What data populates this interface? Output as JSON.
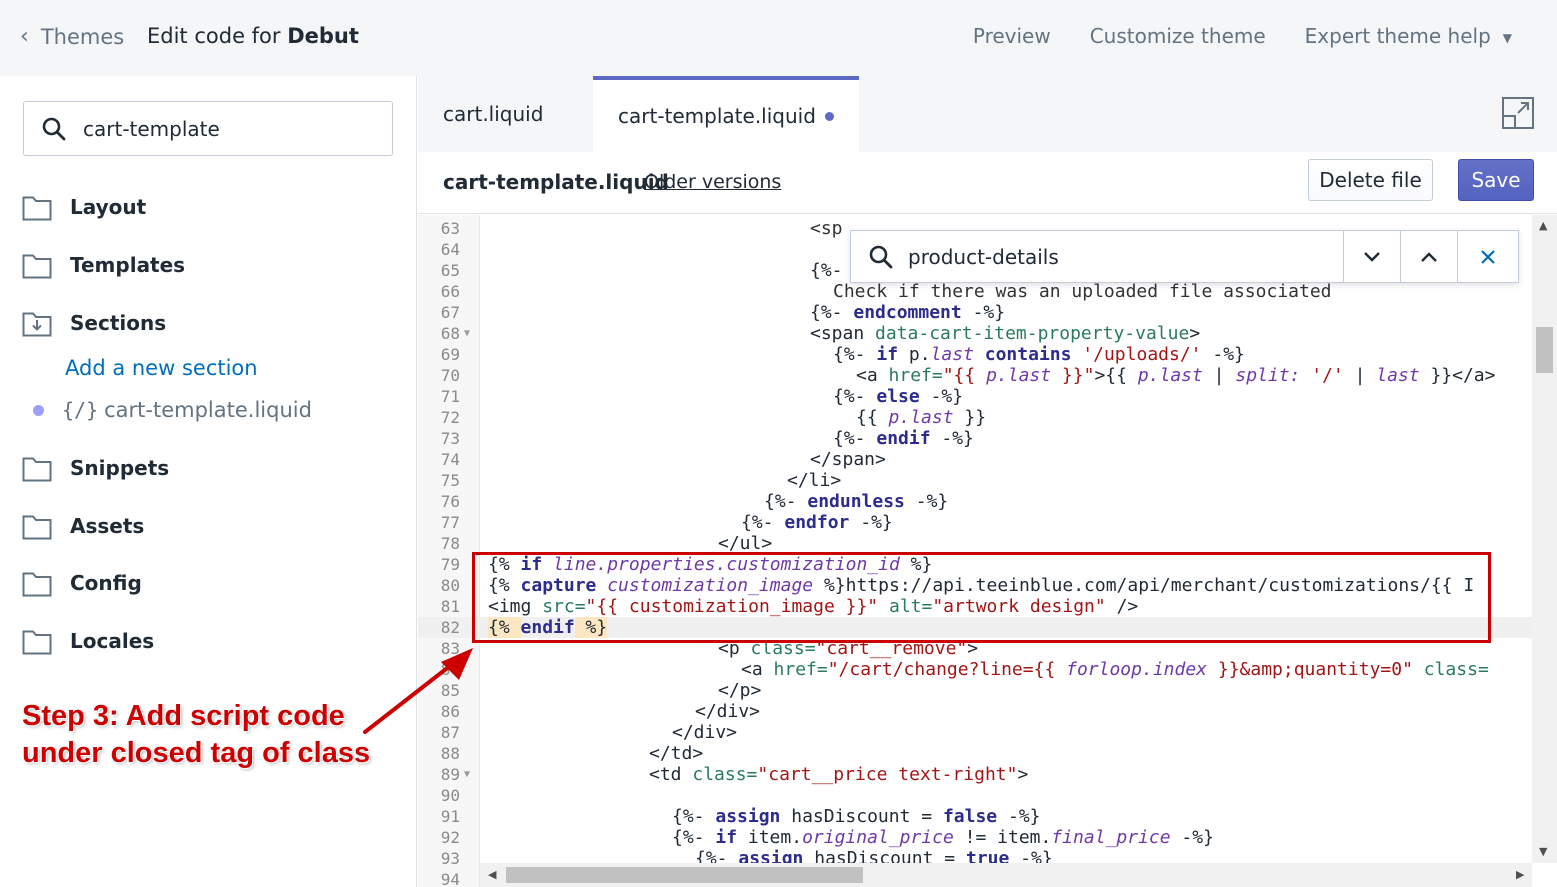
{
  "topbar": {
    "back_label": "Themes",
    "title_prefix": "Edit code for ",
    "title_theme": "Debut",
    "links": {
      "preview": "Preview",
      "customize": "Customize theme",
      "help": "Expert theme help"
    }
  },
  "sidebar": {
    "search_value": "cart-template",
    "folders": {
      "layout": "Layout",
      "templates": "Templates",
      "sections": "Sections",
      "snippets": "Snippets",
      "assets": "Assets",
      "config": "Config",
      "locales": "Locales"
    },
    "add_section": "Add a new section",
    "active_file_icon": "{/}",
    "active_file": "cart-template.liquid"
  },
  "annotation": {
    "line1": "Step 3: Add script code",
    "line2": "under closed tag of class"
  },
  "tabs": {
    "tab1": "cart.liquid",
    "tab2": "cart-template.liquid"
  },
  "file_header": {
    "name": "cart-template.liquid",
    "older_versions": "Older versions",
    "delete": "Delete file",
    "save": "Save"
  },
  "find": {
    "query": "product-details"
  },
  "code": {
    "line_numbers": [
      "63",
      "64",
      "65",
      "66",
      "67",
      "68",
      "69",
      "70",
      "71",
      "72",
      "73",
      "74",
      "75",
      "76",
      "77",
      "78",
      "79",
      "80",
      "81",
      "82",
      "83",
      "84",
      "85",
      "86",
      "87",
      "88",
      "89",
      "90",
      "91",
      "92",
      "93",
      "94"
    ],
    "l63": "<sp",
    "l65": "{%-",
    "l66": "Check if there was an uploaded file associated",
    "l67a": "{%- ",
    "l67b": "endcomment",
    "l67c": " -%}",
    "l68a": "<span ",
    "l68b": "data-cart-item-property-value",
    "l68c": ">",
    "l69a": "{%- ",
    "l69b": "if",
    "l69c": " p.",
    "l69d": "last",
    "l69e": " contains ",
    "l69f": "'/uploads/'",
    "l69g": " -%}",
    "l70a": "<a ",
    "l70b": "href=",
    "l70c": "\"{{ ",
    "l70d": "p.last",
    "l70e": " }}\"",
    "l70f": ">{{ ",
    "l70g": "p.last",
    "l70h": " | ",
    "l70i": "split:",
    "l70j": " '/'",
    "l70k": " | ",
    "l70l": "last",
    "l70m": " }}</a>",
    "l71a": "{%- ",
    "l71b": "else",
    "l71c": " -%}",
    "l72a": "{{ ",
    "l72b": "p.last",
    "l72c": " }}",
    "l73a": "{%- ",
    "l73b": "endif",
    "l73c": " -%}",
    "l74": "</span>",
    "l75": "</li>",
    "l76a": "{%- ",
    "l76b": "endunless",
    "l76c": " -%}",
    "l77a": "{%- ",
    "l77b": "endfor",
    "l77c": " -%}",
    "l78": "</ul>",
    "l79a": "{% ",
    "l79b": "if",
    "l79c": " line.properties.customization_id",
    "l79d": " %}",
    "l80a": "{% ",
    "l80b": "capture",
    "l80c": " customization_image",
    "l80d": " %}https://api.teeinblue.com/api/merchant/customizations/{{ I",
    "l81a": "<img ",
    "l81b": "src=",
    "l81c": "\"{{ customization_image }}\"",
    "l81d": " alt=",
    "l81e": "\"artwork design\"",
    "l81f": " />",
    "l82a": "{% ",
    "l82b": "endif",
    "l82c": " %}",
    "l83a": "<p ",
    "l83b": "class=",
    "l83c": "\"cart__remove\"",
    "l83d": ">",
    "l84a": "<a ",
    "l84b": "href=",
    "l84c": "\"/cart/change?line={{ ",
    "l84d": "forloop.index",
    "l84e": " }}&amp;quantity=0\"",
    "l84f": " class=",
    "l85": "</p>",
    "l86": "</div>",
    "l87": "</div>",
    "l88": "</td>",
    "l89a": "<td ",
    "l89b": "class=",
    "l89c": "\"cart__price text-right\"",
    "l89d": ">",
    "l91a": "{%- ",
    "l91b": "assign",
    "l91c": " hasDiscount = ",
    "l91d": "false",
    "l91e": " -%}",
    "l92a": "{%- ",
    "l92b": "if",
    "l92c": " item.",
    "l92d": "original_price",
    "l92e": " != item.",
    "l92f": "final_price",
    "l92g": " -%}",
    "l93a": "{%- ",
    "l93b": "assign",
    "l93c": " hasDiscount = ",
    "l93d": "true",
    "l93e": " -%}"
  },
  "colors": {
    "accent": "#5c6ac4",
    "link": "#006fbb",
    "annotation": "#cc0000"
  }
}
